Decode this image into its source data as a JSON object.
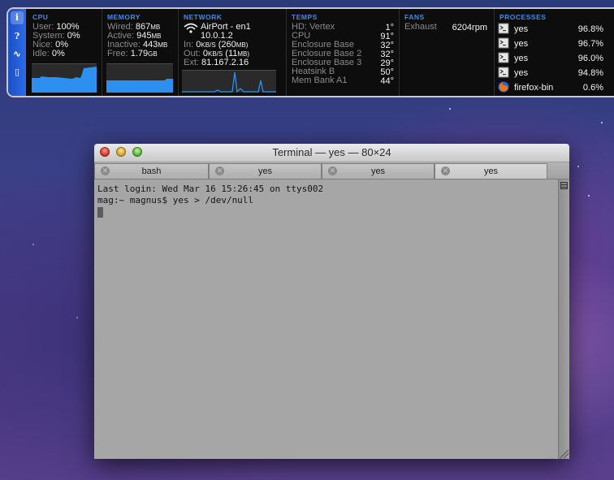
{
  "istat": {
    "tabs": [
      {
        "icon": "info-icon",
        "glyph": "i"
      },
      {
        "icon": "help-icon",
        "glyph": "?"
      },
      {
        "icon": "pulse-icon",
        "glyph": "∿"
      },
      {
        "icon": "device-icon",
        "glyph": "▯"
      }
    ],
    "cpu": {
      "header": "CPU",
      "rows": [
        {
          "label": "User:",
          "value": "100%"
        },
        {
          "label": "System:",
          "value": "0%"
        },
        {
          "label": "Nice:",
          "value": "0%"
        },
        {
          "label": "Idle:",
          "value": "0%"
        }
      ]
    },
    "memory": {
      "header": "MEMORY",
      "rows": [
        {
          "label": "Wired:",
          "value": "867",
          "unit": "MB"
        },
        {
          "label": "Active:",
          "value": "945",
          "unit": "MB"
        },
        {
          "label": "Inactive:",
          "value": "443",
          "unit": "MB"
        },
        {
          "label": "Free:",
          "value": "1.79",
          "unit": "GB"
        }
      ]
    },
    "network": {
      "header": "NETWORK",
      "interface": "AirPort - en1",
      "ip": "10.0.1.2",
      "in_label": "In:",
      "in_value": "0",
      "in_unit": "KB/S",
      "in_total": "(260",
      "in_total_unit": "MB)",
      "out_label": "Out:",
      "out_value": "0",
      "out_unit": "KB/S",
      "out_total": "(11",
      "out_total_unit": "MB)",
      "ext_label": "Ext:",
      "ext_value": "81.167.2.16"
    },
    "temps": {
      "header": "TEMPS",
      "rows": [
        {
          "label": "HD: Vertex",
          "value": "1°"
        },
        {
          "label": "CPU",
          "value": "91°"
        },
        {
          "label": "Enclosure Base",
          "value": "32°"
        },
        {
          "label": "Enclosure Base 2",
          "value": "32°"
        },
        {
          "label": "Enclosure Base 3",
          "value": "29°"
        },
        {
          "label": "Heatsink B",
          "value": "50°"
        },
        {
          "label": "Mem Bank A1",
          "value": "44°"
        }
      ]
    },
    "fans": {
      "header": "FANS",
      "rows": [
        {
          "label": "Exhaust",
          "value": "6204rpm"
        }
      ]
    },
    "processes": {
      "header": "PROCESSES",
      "rows": [
        {
          "name": "yes",
          "pct": "96.8%",
          "icon": "terminal-app-icon"
        },
        {
          "name": "yes",
          "pct": "96.7%",
          "icon": "terminal-app-icon"
        },
        {
          "name": "yes",
          "pct": "96.0%",
          "icon": "terminal-app-icon"
        },
        {
          "name": "yes",
          "pct": "94.8%",
          "icon": "terminal-app-icon"
        },
        {
          "name": "firefox-bin",
          "pct": "0.6%",
          "icon": "firefox-icon"
        }
      ]
    }
  },
  "terminal": {
    "title": "Terminal — yes — 80×24",
    "tabs": [
      {
        "label": "bash",
        "active": false
      },
      {
        "label": "yes",
        "active": false
      },
      {
        "label": "yes",
        "active": false
      },
      {
        "label": "yes",
        "active": true
      }
    ],
    "lines": [
      "Last login: Wed Mar 16 15:26:45 on ttys002",
      "mag:~ magnus$ yes > /dev/null"
    ]
  }
}
